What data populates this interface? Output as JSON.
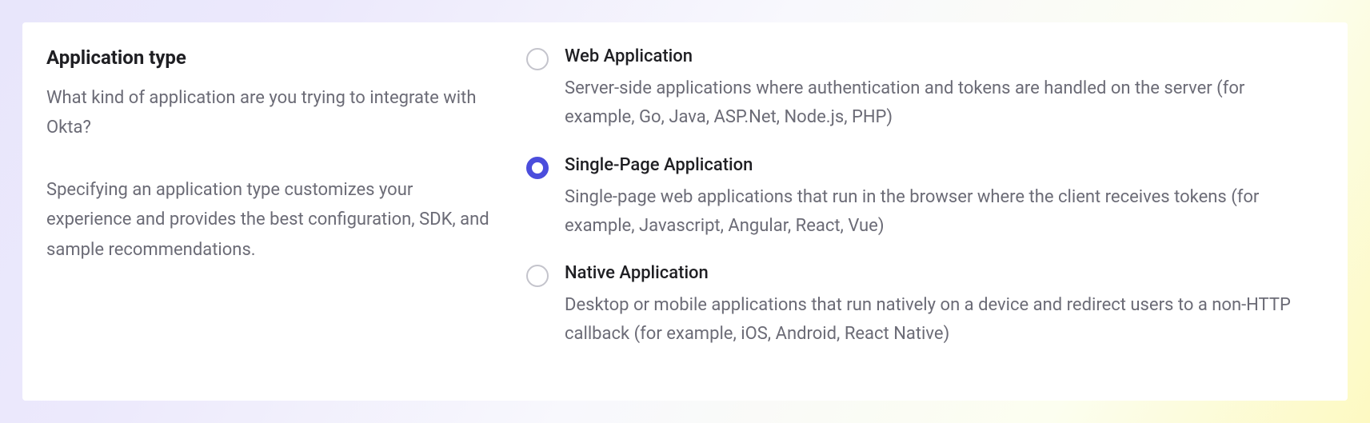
{
  "section": {
    "title": "Application type",
    "question": "What kind of application are you trying to integrate with Okta?",
    "explain": "Specifying an application type customizes your experience and provides the best configuration, SDK, and sample recommendations."
  },
  "options": [
    {
      "label": "Web Application",
      "desc": "Server-side applications where authentication and tokens are handled on the server (for example, Go, Java, ASP.Net, Node.js, PHP)",
      "selected": false
    },
    {
      "label": "Single-Page Application",
      "desc": "Single-page web applications that run in the browser where the client receives tokens (for example, Javascript, Angular, React, Vue)",
      "selected": true
    },
    {
      "label": "Native Application",
      "desc": "Desktop or mobile applications that run natively on a device and redirect users to a non-HTTP callback (for example, iOS, Android, React Native)",
      "selected": false
    }
  ]
}
